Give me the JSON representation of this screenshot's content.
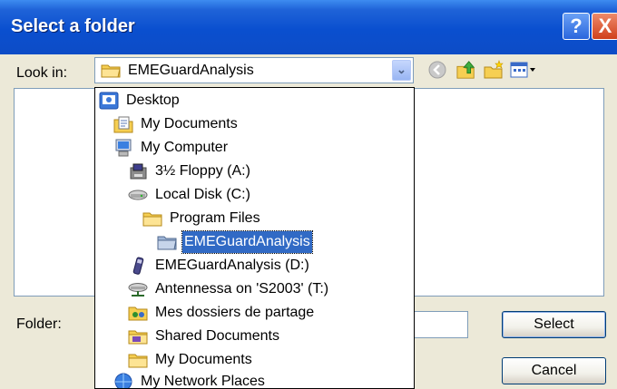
{
  "window": {
    "title": "Select a folder",
    "help_label": "?",
    "close_label": "X"
  },
  "toolbar": {
    "look_in_label": "Look in:",
    "look_in_value": "EMEGuardAnalysis",
    "icons": [
      "back-icon",
      "up-folder-icon",
      "new-folder-icon",
      "views-menu-icon"
    ]
  },
  "dropdown": {
    "items": [
      {
        "label": "Desktop",
        "icon": "desktop-icon"
      },
      {
        "label": "My Documents",
        "icon": "documents-icon"
      },
      {
        "label": "My Computer",
        "icon": "computer-icon"
      },
      {
        "label": "3½ Floppy (A:)",
        "icon": "floppy-icon"
      },
      {
        "label": "Local Disk (C:)",
        "icon": "hard-disk-icon"
      },
      {
        "label": "Program Files",
        "icon": "folder-icon"
      },
      {
        "label": "EMEGuardAnalysis",
        "icon": "open-folder-icon",
        "selected": true
      },
      {
        "label": "EMEGuardAnalysis (D:)",
        "icon": "drive-icon"
      },
      {
        "label": "Antennessa on 'S2003' (T:)",
        "icon": "network-drive-icon"
      },
      {
        "label": "Mes dossiers de partage",
        "icon": "shared-folder-icon"
      },
      {
        "label": "Shared Documents",
        "icon": "folder-icon"
      },
      {
        "label": "My Documents",
        "icon": "folder-icon"
      },
      {
        "label": "My Network Places",
        "icon": "network-icon"
      }
    ]
  },
  "footer": {
    "folder_label": "Folder:",
    "folder_value": "",
    "select_label": "Select",
    "cancel_label": "Cancel"
  },
  "colors": {
    "titlebar": "#0a4fcf",
    "dialog_bg": "#ece9d8",
    "selection": "#316ac5",
    "folder_yellow": "#f6cf52"
  }
}
